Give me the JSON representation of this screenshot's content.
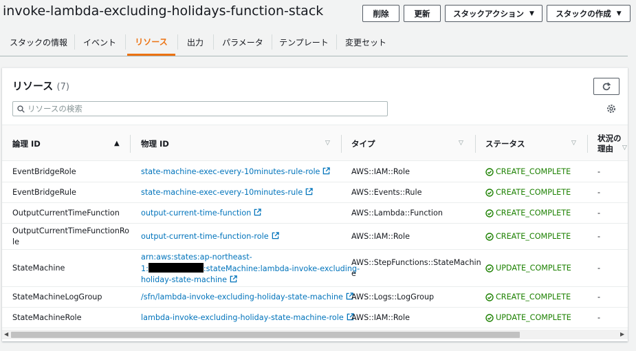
{
  "header": {
    "title": "invoke-lambda-excluding-holidays-function-stack",
    "buttons": {
      "delete": "削除",
      "update": "更新",
      "stack_actions": "スタックアクション",
      "create_stack": "スタックの作成"
    }
  },
  "tabs": [
    "スタックの情報",
    "イベント",
    "リソース",
    "出力",
    "パラメータ",
    "テンプレート",
    "変更セット"
  ],
  "active_tab": "リソース",
  "resources": {
    "title": "リソース",
    "count": "(7)",
    "search_placeholder": "リソースの検索",
    "columns": {
      "logical_id": "論理 ID",
      "physical_id": "物理 ID",
      "type": "タイプ",
      "status": "ステータス",
      "status_reason_1": "状況の",
      "status_reason_2": "理由"
    },
    "rows": [
      {
        "logical_1": "EventBridgeRole",
        "logical_2": "",
        "physical_1": "state-machine-exec-every-10minutes-rule-role",
        "physical_2": "",
        "physical_3": "",
        "type_1": "AWS::IAM::Role",
        "type_2": "",
        "status": "CREATE_COMPLETE",
        "reason": "-"
      },
      {
        "logical_1": "EventBridgeRule",
        "logical_2": "",
        "physical_1": "state-machine-exec-every-10minutes-rule",
        "physical_2": "",
        "physical_3": "",
        "type_1": "AWS::Events::Rule",
        "type_2": "",
        "status": "CREATE_COMPLETE",
        "reason": "-"
      },
      {
        "logical_1": "OutputCurrentTimeFunction",
        "logical_2": "",
        "physical_1": "output-current-time-function",
        "physical_2": "",
        "physical_3": "",
        "type_1": "AWS::Lambda::Function",
        "type_2": "",
        "status": "CREATE_COMPLETE",
        "reason": "-"
      },
      {
        "logical_1": "OutputCurrentTimeFunctionRo",
        "logical_2": "le",
        "physical_1": "output-current-time-function-role",
        "physical_2": "",
        "physical_3": "",
        "type_1": "AWS::IAM::Role",
        "type_2": "",
        "status": "CREATE_COMPLETE",
        "reason": "-"
      },
      {
        "logical_1": "StateMachine",
        "logical_2": "",
        "physical_1": "arn:aws:states:ap-northeast-",
        "physical_2": ":stateMachine:lambda-invoke-excluding-",
        "physical_3": "holiday-state-machine",
        "physical_2_prefix": "1:",
        "type_1": "AWS::StepFunctions::StateMachin",
        "type_2": "e",
        "status": "UPDATE_COMPLETE",
        "reason": "-"
      },
      {
        "logical_1": "StateMachineLogGroup",
        "logical_2": "",
        "physical_1": "/sfn/lambda-invoke-excluding-holiday-state-machine",
        "physical_2": "",
        "physical_3": "",
        "type_1": "AWS::Logs::LogGroup",
        "type_2": "",
        "status": "CREATE_COMPLETE",
        "reason": "-"
      },
      {
        "logical_1": "StateMachineRole",
        "logical_2": "",
        "physical_1": "lambda-invoke-excluding-holiday-state-machine-role",
        "physical_2": "",
        "physical_3": "",
        "type_1": "AWS::IAM::Role",
        "type_2": "",
        "status": "UPDATE_COMPLETE",
        "reason": "-"
      }
    ]
  },
  "icons": {
    "refresh": "refresh-icon",
    "search": "search-icon",
    "settings": "gear-icon",
    "external": "external-link-icon",
    "status": "check-circle-icon"
  },
  "colors": {
    "accent": "#ec7211",
    "link": "#0073bb",
    "success": "#1d8102"
  }
}
